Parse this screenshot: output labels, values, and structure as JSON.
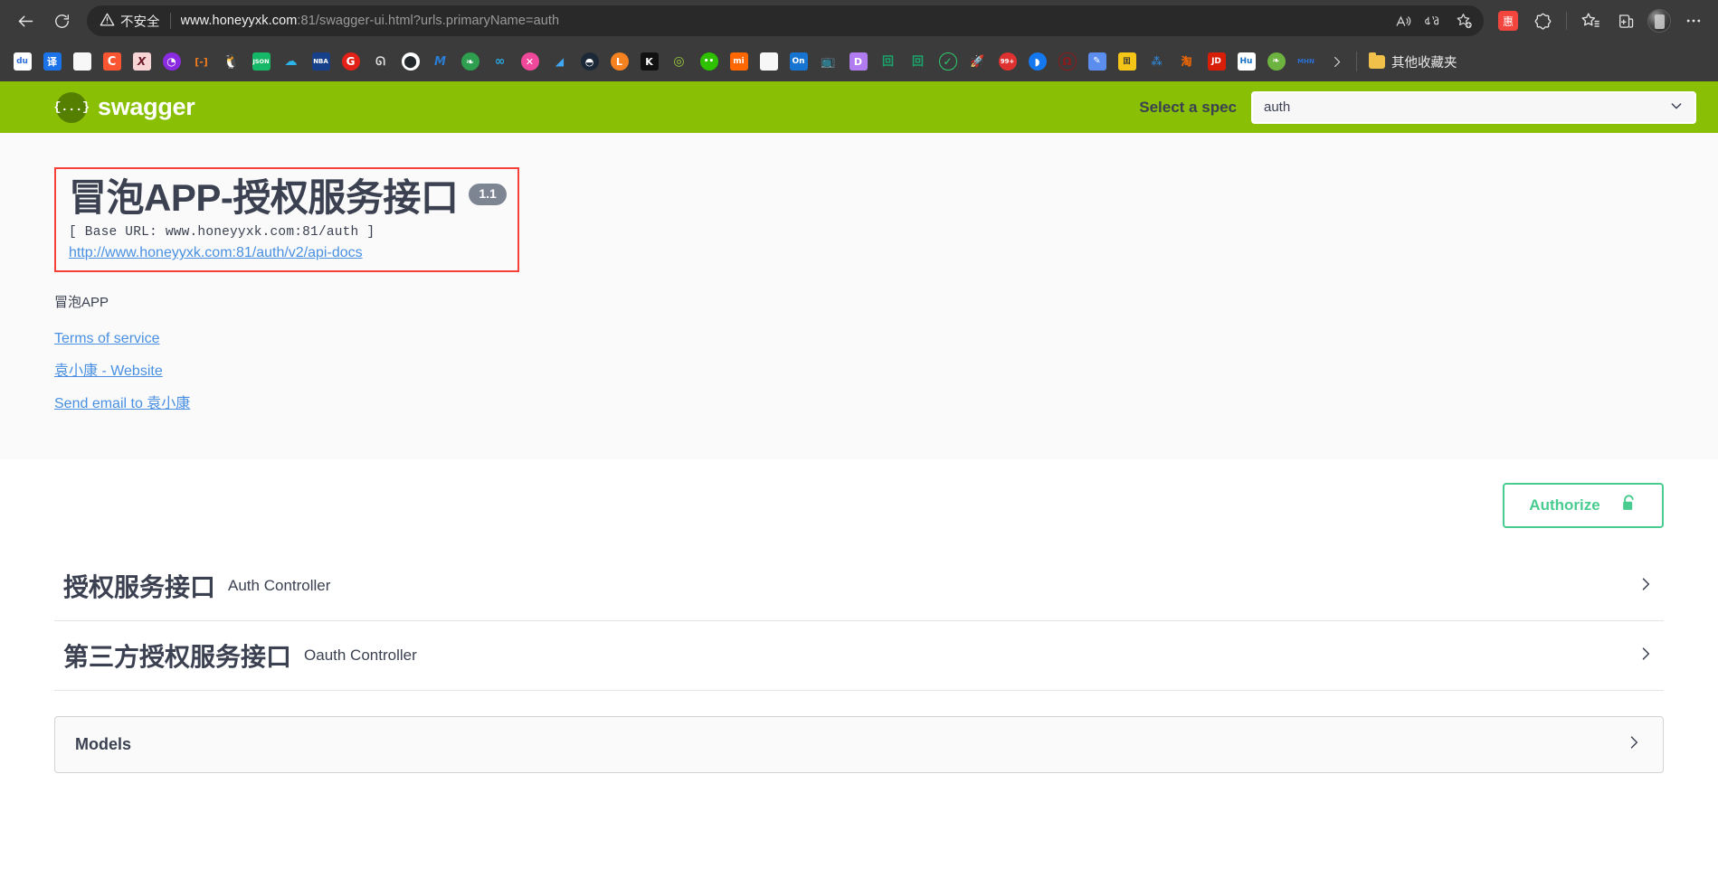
{
  "browser": {
    "back_label": "back-arrow",
    "reload_label": "reload",
    "security": {
      "icon": "warning-triangle-icon",
      "text": "不安全"
    },
    "url": {
      "host": "www.honeyyxk.com",
      "path": ":81/swagger-ui.html?urls.primaryName=auth",
      "full": "www.honeyyxk.com:81/swagger-ui.html?urls.primaryName=auth"
    },
    "omnibox_icons": [
      {
        "name": "read-aloud-icon",
        "glyph": "A"
      },
      {
        "name": "translate-icon",
        "glyph": "aあ"
      },
      {
        "name": "add-favorite-icon",
        "glyph": "star-plus"
      }
    ],
    "toolbar_icons": [
      {
        "name": "extension-huiwang-icon",
        "glyph": "惠"
      },
      {
        "name": "browser-essentials-icon",
        "glyph": "split-circle"
      },
      {
        "name": "favorites-icon",
        "glyph": "star-list"
      },
      {
        "name": "collections-icon",
        "glyph": "collection-plus"
      },
      {
        "name": "profile-avatar",
        "glyph": "avatar"
      },
      {
        "name": "settings-and-more-icon",
        "glyph": "…"
      }
    ],
    "bookmarks": [
      {
        "name": "baidu",
        "label": "du",
        "bg": "#ffffff",
        "fg": "#2e6fd9",
        "shape": "square"
      },
      {
        "name": "translate",
        "label": "译",
        "bg": "#1a73e8",
        "fg": "#ffffff",
        "shape": "square"
      },
      {
        "name": "document",
        "label": "",
        "bg": "#f5f5f5",
        "fg": "#555555",
        "shape": "page"
      },
      {
        "name": "csdn",
        "label": "C",
        "bg": "#fc5531",
        "fg": "#ffffff",
        "shape": "square"
      },
      {
        "name": "xmind",
        "label": "X",
        "bg": "#f7d4d6",
        "fg": "#7a1f2a",
        "shape": "square"
      },
      {
        "name": "purple-disc",
        "label": "",
        "bg": "#8a2be2",
        "fg": "#ffffff",
        "shape": "round"
      },
      {
        "name": "link-orange",
        "label": "[-]",
        "bg": "#3b3b3b",
        "fg": "#f07c1e",
        "shape": "square"
      },
      {
        "name": "qq-penguin",
        "label": "",
        "bg": "#3b3b3b",
        "fg": "#ffffff",
        "shape": "penguin"
      },
      {
        "name": "json-viewer",
        "label": "JSON",
        "bg": "#14b866",
        "fg": "#ffffff",
        "shape": "square"
      },
      {
        "name": "cloud-blue",
        "label": "",
        "bg": "#3b3b3b",
        "fg": "#2bb4e8",
        "shape": "cloud"
      },
      {
        "name": "nba",
        "label": "",
        "bg": "#17408b",
        "fg": "#ffffff",
        "shape": "nba"
      },
      {
        "name": "g-red",
        "label": "G",
        "bg": "#e32119",
        "fg": "#ffffff",
        "shape": "round"
      },
      {
        "name": "sketch-gray",
        "label": "",
        "bg": "#3b3b3b",
        "fg": "#e0e0e0",
        "shape": "squiggle"
      },
      {
        "name": "github",
        "label": "",
        "bg": "#ffffff",
        "fg": "#24292e",
        "shape": "github"
      },
      {
        "name": "m-blue",
        "label": "M",
        "bg": "#3b3b3b",
        "fg": "#2b7cd3",
        "shape": "square"
      },
      {
        "name": "leaf-green",
        "label": "",
        "bg": "#2e9e4f",
        "fg": "#ffffff",
        "shape": "round"
      },
      {
        "name": "infinity",
        "label": "∞",
        "bg": "#3b3b3b",
        "fg": "#29a8e0",
        "shape": "square"
      },
      {
        "name": "x-pink",
        "label": "X",
        "bg": "#f0499c",
        "fg": "#ffffff",
        "shape": "round"
      },
      {
        "name": "kuaidi",
        "label": "",
        "bg": "#3b3b3b",
        "fg": "#3fa9f5",
        "shape": "swoosh"
      },
      {
        "name": "steam",
        "label": "",
        "bg": "#1b2838",
        "fg": "#ffffff",
        "shape": "round"
      },
      {
        "name": "l-orange",
        "label": "L",
        "bg": "#f58220",
        "fg": "#ffffff",
        "shape": "round"
      },
      {
        "name": "k-black",
        "label": "K",
        "bg": "#111111",
        "fg": "#ffffff",
        "shape": "square"
      },
      {
        "name": "spiral-green",
        "label": "",
        "bg": "#3b3b3b",
        "fg": "#9ccc3c",
        "shape": "round"
      },
      {
        "name": "wechat",
        "label": "",
        "bg": "#2dc100",
        "fg": "#ffffff",
        "shape": "round"
      },
      {
        "name": "xiaomi",
        "label": "mi",
        "bg": "#ff6700",
        "fg": "#ffffff",
        "shape": "square"
      },
      {
        "name": "page-white",
        "label": "",
        "bg": "#f5f5f5",
        "fg": "#555555",
        "shape": "page"
      },
      {
        "name": "onenote",
        "label": "On",
        "bg": "#1874d1",
        "fg": "#ffffff",
        "shape": "square"
      },
      {
        "name": "bilibili",
        "label": "",
        "bg": "#3b3b3b",
        "fg": "#00a1d6",
        "shape": "tv"
      },
      {
        "name": "d-purple",
        "label": "D",
        "bg": "#b07cf0",
        "fg": "#ffffff",
        "shape": "square"
      },
      {
        "name": "green-code",
        "label": "",
        "bg": "#3b3b3b",
        "fg": "#1aa36a",
        "shape": "square"
      },
      {
        "name": "green-code2",
        "label": "",
        "bg": "#3b3b3b",
        "fg": "#1aa36a",
        "shape": "square"
      },
      {
        "name": "check-green",
        "label": "✓",
        "bg": "#3b3b3b",
        "fg": "#2ecc71",
        "shape": "round"
      },
      {
        "name": "rocket",
        "label": "",
        "bg": "#3b3b3b",
        "fg": "#4a90e2",
        "shape": "rocket"
      },
      {
        "name": "notify-99",
        "label": "99+",
        "bg": "#e03131",
        "fg": "#ffffff",
        "shape": "round"
      },
      {
        "name": "blue-drop",
        "label": "",
        "bg": "#1478f0",
        "fg": "#ffffff",
        "shape": "round"
      },
      {
        "name": "railway",
        "label": "",
        "bg": "#3b3b3b",
        "fg": "#8b1a1a",
        "shape": "round"
      },
      {
        "name": "pencil-blue",
        "label": "",
        "bg": "#5b8def",
        "fg": "#ffffff",
        "shape": "square"
      },
      {
        "name": "yellow-note",
        "label": "",
        "bg": "#f5c518",
        "fg": "#333333",
        "shape": "square"
      },
      {
        "name": "fan-blue",
        "label": "",
        "bg": "#3b3b3b",
        "fg": "#2f80c9",
        "shape": "fan"
      },
      {
        "name": "taobao",
        "label": "淘",
        "bg": "#3b3b3b",
        "fg": "#ff6a00",
        "shape": "square"
      },
      {
        "name": "jd",
        "label": "JD",
        "bg": "#d81e06",
        "fg": "#ffffff",
        "shape": "square"
      },
      {
        "name": "huawei",
        "label": "Hu",
        "bg": "#ffffff",
        "fg": "#1570c4",
        "shape": "square"
      },
      {
        "name": "spring",
        "label": "",
        "bg": "#6db33f",
        "fg": "#ffffff",
        "shape": "round"
      },
      {
        "name": "mhn-blue",
        "label": "MHN",
        "bg": "#3b3b3b",
        "fg": "#2b6fd4",
        "shape": "square"
      }
    ],
    "bookmarks_overflow_label": "»",
    "other_favorites_label": "其他收藏夹"
  },
  "swagger": {
    "logo_mark": "{...}",
    "logo_text": "swagger",
    "spec_selector": {
      "label": "Select a spec",
      "value": "auth",
      "options": [
        "auth"
      ]
    },
    "info": {
      "title": "冒泡APP-授权服务接口",
      "version": "1.1",
      "base_url_text": "[ Base URL: www.honeyyxk.com:81/auth ]",
      "api_docs_url": "http://www.honeyyxk.com:81/auth/v2/api-docs",
      "description": "冒泡APP",
      "links": [
        {
          "name": "terms-of-service-link",
          "label": "Terms of service"
        },
        {
          "name": "website-link",
          "label": "袁小康 - Website"
        },
        {
          "name": "contact-email-link",
          "label": "Send email to 袁小康"
        }
      ],
      "highlight_color": "#f8403a"
    },
    "authorize": {
      "label": "Authorize",
      "icon": "unlock-icon",
      "color": "#49cc90"
    },
    "tags": [
      {
        "name": "授权服务接口",
        "description": "Auth Controller",
        "expand_icon": "chevron-right-icon"
      },
      {
        "name": "第三方授权服务接口",
        "description": "Oauth Controller",
        "expand_icon": "chevron-right-icon"
      }
    ],
    "models": {
      "title": "Models",
      "expand_icon": "chevron-right-icon"
    },
    "theme": {
      "topbar_green": "#89bf04",
      "text_color": "#3b4151",
      "link_color": "#4990e2"
    }
  }
}
